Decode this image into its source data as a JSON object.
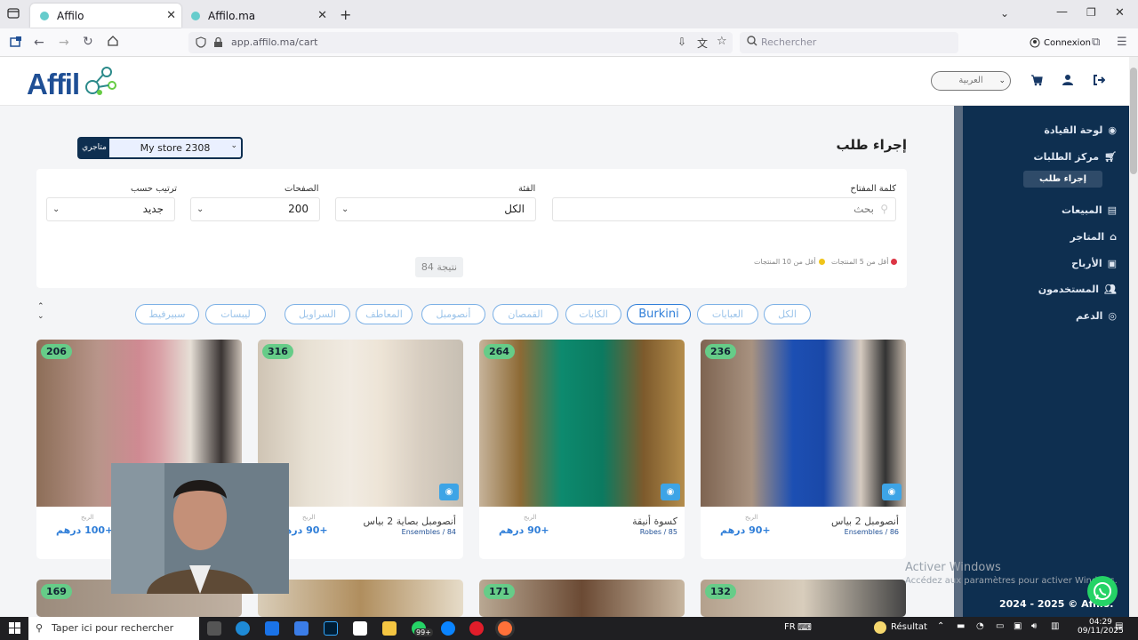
{
  "browser": {
    "tabs": [
      {
        "title": "Affilo"
      },
      {
        "title": "Affilo.ma"
      }
    ],
    "url": "app.affilo.ma/cart",
    "search_placeholder": "Rechercher",
    "account_label": "Connexion"
  },
  "site": {
    "logo_text": "Affil",
    "language": "العربية",
    "footer": "2024 - 2025 © Affilo.",
    "accent_color": "#2f7ed8",
    "sidebar_color": "#0e2f50"
  },
  "sidebar": {
    "items": [
      {
        "label": "لوحة القيادة",
        "icon": "dashboard-icon"
      },
      {
        "label": "مركز الطلبات",
        "icon": "cart-icon"
      },
      {
        "label": "إجراء طلب",
        "icon": "",
        "active": true
      },
      {
        "label": "المبيعات",
        "icon": "sales-icon"
      },
      {
        "label": "المتاجر",
        "icon": "store-icon"
      },
      {
        "label": "الأرباح",
        "icon": "money-icon"
      },
      {
        "label": "المستخدمون",
        "icon": "users-icon"
      },
      {
        "label": "الدعم",
        "icon": "support-icon"
      }
    ]
  },
  "main": {
    "store_label": "متاجري",
    "store_value": "My store 2308",
    "page_title": "إجراء طلب",
    "filters": {
      "keyword_label": "كلمة المفتاح",
      "keyword_placeholder": "بحث",
      "category_label": "الفئة",
      "category_value": "الكل",
      "pages_label": "الصفحات",
      "pages_value": "200",
      "sort_label": "ترتيب حسب",
      "sort_value": "جديد"
    },
    "legend": [
      {
        "text": "أقل من 5 المنتجات",
        "color": "#dc3545"
      },
      {
        "text": "أقل من 10 المنتجات",
        "color": "#f0c419"
      }
    ],
    "result_count": "84 نتيجة",
    "category_pills": [
      "الكل",
      "العبايات",
      "Burkini",
      "الكابات",
      "القمصان",
      "أنصومبل",
      "المعاطف",
      "السراويل",
      "ليبسات",
      "سبيرفيط"
    ]
  },
  "products": [
    {
      "stock": "206",
      "name": "",
      "category": "",
      "profit_label": "الربح",
      "price": "+100 درهم"
    },
    {
      "stock": "316",
      "name": "أنصومبل بصاية 2 بياس",
      "category": "Ensembles / 84",
      "profit_label": "الربح",
      "price": "+90 درهم"
    },
    {
      "stock": "264",
      "name": "كسوة أنيقة",
      "category": "Robes / 85",
      "profit_label": "الربح",
      "price": "+90 درهم"
    },
    {
      "stock": "236",
      "name": "أنصومبل 2 بياس",
      "category": "Ensembles / 86",
      "profit_label": "الربح",
      "price": "+90 درهم"
    }
  ],
  "products_row2": [
    {
      "stock": "169"
    },
    {
      "stock": ""
    },
    {
      "stock": "171"
    },
    {
      "stock": "132"
    }
  ],
  "windows_watermark": {
    "line1": "Activer Windows",
    "line2": "Accédez aux paramètres pour activer Windows."
  },
  "taskbar": {
    "search_placeholder": "Taper ici pour rechercher",
    "badge": "99+",
    "language": "FR",
    "weather": "Résultat",
    "time": "04:29",
    "date": "09/11/2025"
  }
}
